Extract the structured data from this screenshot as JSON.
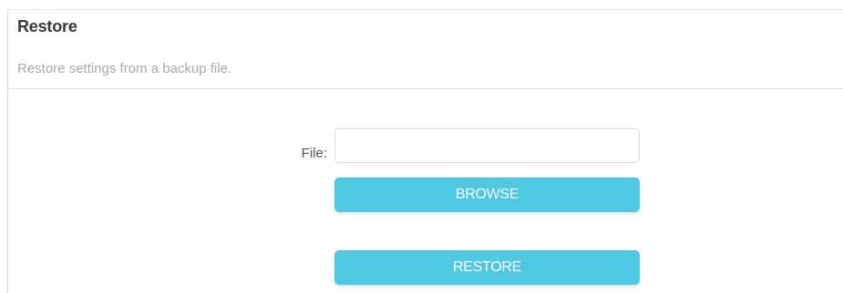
{
  "section": {
    "title": "Restore",
    "description": "Restore settings from a backup file."
  },
  "form": {
    "file_label": "File:",
    "file_value": "",
    "browse_label": "BROWSE",
    "restore_label": "RESTORE"
  },
  "colors": {
    "button_bg": "#4ec9e1",
    "button_text": "#ffffff",
    "title_text": "#3a3a3a",
    "description_text": "#a9a9a9"
  }
}
